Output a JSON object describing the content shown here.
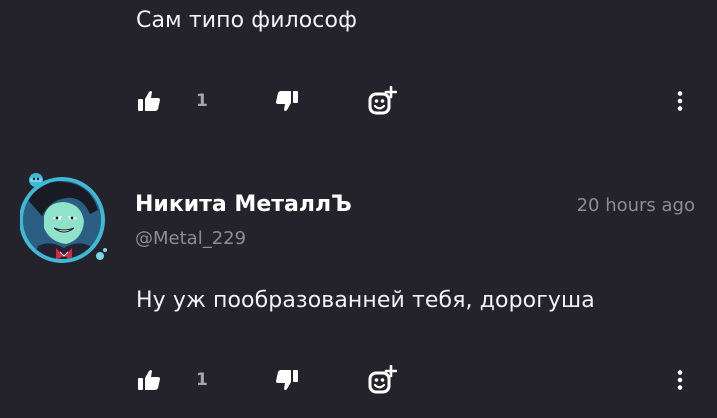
{
  "comments": [
    {
      "text": "Сам типо философ",
      "likes": "1",
      "icons": {
        "like": "thumbs-up-icon",
        "dislike": "thumbs-down-icon",
        "react": "add-reaction-icon",
        "more": "more-vertical-icon"
      }
    },
    {
      "author": "Никита МеталлЪ",
      "handle": "@Metal_229",
      "time": "20 hours ago",
      "avatar": "avatar-image",
      "text": "Ну уж пообразованней тебя, дорогуша",
      "likes": "1",
      "icons": {
        "like": "thumbs-up-icon",
        "dislike": "thumbs-down-icon",
        "react": "add-reaction-icon",
        "more": "more-vertical-icon"
      }
    }
  ],
  "colors": {
    "background": "#24232b",
    "text": "#f2f2f4",
    "muted": "#8d8c96",
    "avatar_ring": "#3fb8d6"
  }
}
